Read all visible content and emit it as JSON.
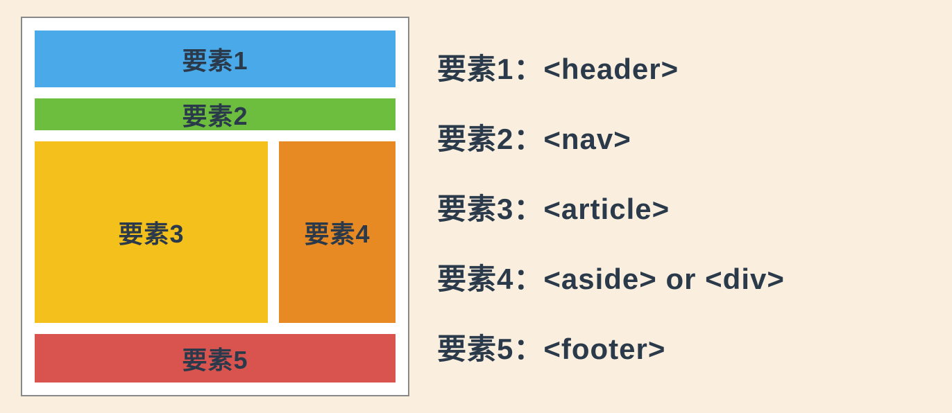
{
  "layout": {
    "header": "要素1",
    "nav": "要素2",
    "article": "要素3",
    "aside": "要素4",
    "footer": "要素5"
  },
  "legend": {
    "item1": "要素1：<header>",
    "item2": "要素2：<nav>",
    "item3": "要素3：<article>",
    "item4": "要素4：<aside> or <div>",
    "item5": "要素5：<footer>"
  },
  "colors": {
    "header": "#4aa9e8",
    "nav": "#6dbe3f",
    "article": "#f3c01c",
    "aside": "#e88a23",
    "footer": "#d9544f",
    "text": "#2b3a4a",
    "background": "#faefde"
  }
}
